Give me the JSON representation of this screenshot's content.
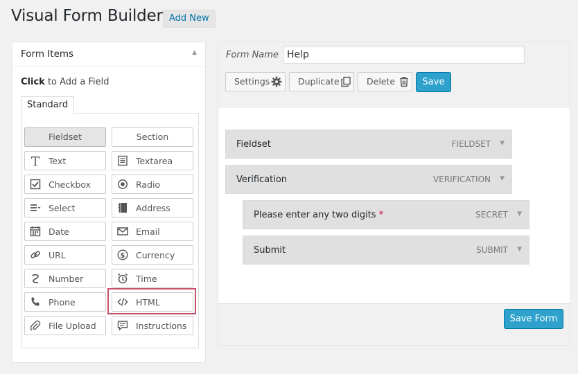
{
  "page": {
    "title": "Visual Form Builder",
    "add_new": "Add New"
  },
  "form_items": {
    "title": "Form Items",
    "hint_bold": "Click",
    "hint_rest": " to Add a Field",
    "tab": "Standard",
    "buttons": [
      {
        "label": "Fieldset",
        "icon": null
      },
      {
        "label": "Section",
        "icon": null
      },
      {
        "label": "Text",
        "icon": "text-icon"
      },
      {
        "label": "Textarea",
        "icon": "textarea-icon"
      },
      {
        "label": "Checkbox",
        "icon": "checkbox-icon"
      },
      {
        "label": "Radio",
        "icon": "radio-icon"
      },
      {
        "label": "Select",
        "icon": "select-icon"
      },
      {
        "label": "Address",
        "icon": "address-icon"
      },
      {
        "label": "Date",
        "icon": "calendar-icon"
      },
      {
        "label": "Email",
        "icon": "envelope-icon"
      },
      {
        "label": "URL",
        "icon": "link-icon"
      },
      {
        "label": "Currency",
        "icon": "dollar-icon"
      },
      {
        "label": "Number",
        "icon": "number-icon"
      },
      {
        "label": "Time",
        "icon": "clock-icon"
      },
      {
        "label": "Phone",
        "icon": "phone-icon"
      },
      {
        "label": "HTML",
        "icon": "code-icon"
      },
      {
        "label": "File Upload",
        "icon": "paperclip-icon"
      },
      {
        "label": "Instructions",
        "icon": "speech-bubble-icon"
      }
    ]
  },
  "form": {
    "name_label": "Form Name",
    "name_value": "Help",
    "settings": "Settings",
    "duplicate": "Duplicate",
    "delete": "Delete",
    "save": "Save",
    "fields": [
      {
        "name": "Fieldset",
        "type": "FIELDSET",
        "required": ""
      },
      {
        "name": "Verification",
        "type": "VERIFICATION",
        "required": ""
      },
      {
        "name": "Please enter any two digits",
        "type": "SECRET",
        "required": "*"
      },
      {
        "name": "Submit",
        "type": "SUBMIT",
        "required": ""
      }
    ],
    "save_form": "Save Form"
  },
  "colors": {
    "primary": "#2ea2cc",
    "link": "#0073aa",
    "highlight": "#c8506a"
  }
}
